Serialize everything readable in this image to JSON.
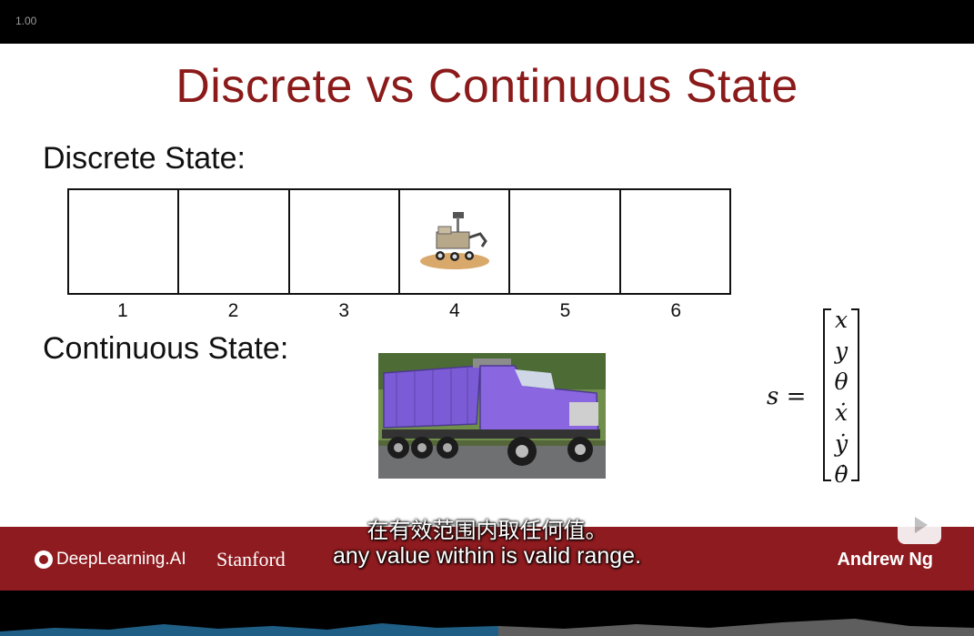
{
  "player": {
    "speed": "1.00"
  },
  "slide": {
    "title": "Discrete vs Continuous State",
    "discrete_label": "Discrete State:",
    "continuous_label": "Continuous State:",
    "cells": [
      "1",
      "2",
      "3",
      "4",
      "5",
      "6"
    ],
    "rover_cell": "4",
    "state_symbol": "s =",
    "state_vector": [
      "x",
      "y",
      "θ",
      "ẋ",
      "ẏ",
      "θ̇"
    ]
  },
  "banner": {
    "left_logo": "DeepLearning.AI",
    "middle": "Stanford",
    "right": "Andrew Ng",
    "color": "#8e1b1f"
  },
  "subtitles": {
    "zh": "在有效范围内取任何值。",
    "en": "any value within is valid range."
  },
  "icons": [
    "play-icon"
  ]
}
